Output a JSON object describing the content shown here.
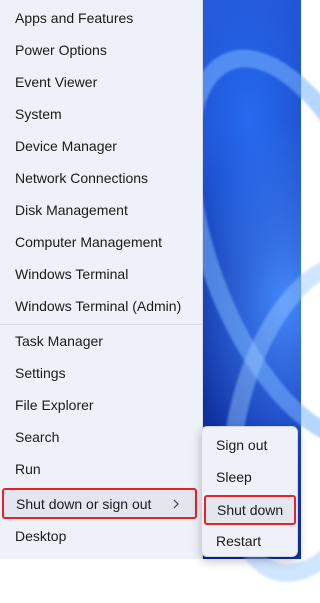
{
  "menu": {
    "items": [
      {
        "label": "Apps and Features"
      },
      {
        "label": "Power Options"
      },
      {
        "label": "Event Viewer"
      },
      {
        "label": "System"
      },
      {
        "label": "Device Manager"
      },
      {
        "label": "Network Connections"
      },
      {
        "label": "Disk Management"
      },
      {
        "label": "Computer Management"
      },
      {
        "label": "Windows Terminal"
      },
      {
        "label": "Windows Terminal (Admin)"
      },
      {
        "label": "Task Manager"
      },
      {
        "label": "Settings"
      },
      {
        "label": "File Explorer"
      },
      {
        "label": "Search"
      },
      {
        "label": "Run"
      },
      {
        "label": "Shut down or sign out"
      },
      {
        "label": "Desktop"
      }
    ]
  },
  "submenu": {
    "items": [
      {
        "label": "Sign out"
      },
      {
        "label": "Sleep"
      },
      {
        "label": "Shut down"
      },
      {
        "label": "Restart"
      }
    ]
  },
  "colors": {
    "highlight_border": "#e0242a",
    "menu_background": "#eef1f7"
  }
}
